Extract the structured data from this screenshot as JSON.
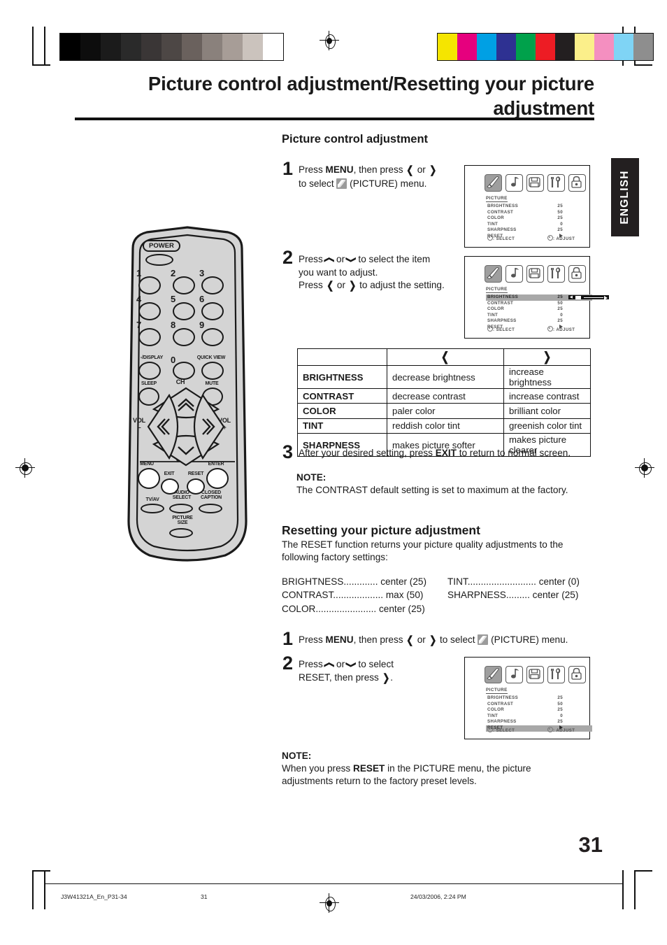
{
  "page": {
    "title": "Picture control adjustment/Resetting your picture adjustment",
    "language_tab": "ENGLISH",
    "page_number": "31"
  },
  "footer": {
    "file": "J3W41321A_En_P31-34",
    "page": "31",
    "timestamp": "24/03/2006, 2:24 PM"
  },
  "sections": {
    "picture_control": {
      "heading": "Picture control adjustment",
      "steps": [
        {
          "num": "1",
          "line1_a": "Press ",
          "line1_b": "MENU",
          "line1_c": ", then press ",
          "line1_d": " or ",
          "line2_a": "to select ",
          "line2_b": " (PICTURE) menu."
        },
        {
          "num": "2",
          "line1_a": "Press ",
          "line1_b": " or ",
          "line1_c": " to select the item",
          "line2": "you want to adjust.",
          "line3_a": "Press ",
          "line3_b": " or ",
          "line3_c": " to adjust the setting."
        },
        {
          "num": "3",
          "text_a": "After your desired setting, press ",
          "text_b": "EXIT",
          "text_c": " to return to normal screen."
        }
      ],
      "note": {
        "label": "NOTE:",
        "text": "The CONTRAST default setting is set to maximum at the factory."
      }
    },
    "resetting": {
      "heading": "Resetting your picture adjustment",
      "intro_line1": "The RESET function returns your picture quality adjustments to the",
      "intro_line2": "following factory settings:",
      "factory_settings": [
        {
          "name": "BRIGHTNESS",
          "dots": "............. ",
          "value": "center (25)"
        },
        {
          "name": "CONTRAST",
          "dots": "................... ",
          "value": "max (50)"
        },
        {
          "name": "COLOR",
          "dots": "....................... ",
          "value": "center (25)"
        },
        {
          "name": "TINT",
          "dots": ".......................... ",
          "value": "center (0)"
        },
        {
          "name": "SHARPNESS",
          "dots": "......... ",
          "value": "center (25)"
        }
      ],
      "steps": [
        {
          "num": "1",
          "a": "Press ",
          "b": "MENU",
          "c": ", then press ",
          "d": " or ",
          "e": " to select ",
          "f": " (PICTURE) menu."
        },
        {
          "num": "2",
          "line1_a": "Press ",
          "line1_b": " or ",
          "line1_c": " to select",
          "line2_a": "RESET, then press ",
          "line2_b": "."
        }
      ],
      "note": {
        "label": "NOTE:",
        "line1_a": "When you press ",
        "line1_b": "RESET",
        "line1_c": " in the PICTURE menu, the picture",
        "line2": "adjustments return to the factory preset levels."
      }
    }
  },
  "adjust_table": {
    "headers": [
      "",
      "left-arrow",
      "right-arrow"
    ],
    "rows": [
      {
        "label": "BRIGHTNESS",
        "left": "decrease brightness",
        "right": "increase brightness"
      },
      {
        "label": "CONTRAST",
        "left": "decrease contrast",
        "right": "increase contrast"
      },
      {
        "label": "COLOR",
        "left": "paler color",
        "right": "brilliant color"
      },
      {
        "label": "TINT",
        "left": "reddish color tint",
        "right": "greenish color tint"
      },
      {
        "label": "SHARPNESS",
        "left": "makes picture softer",
        "right": "makes picture clearer"
      }
    ]
  },
  "osd": {
    "tab_name": "PICTURE",
    "icons": [
      "picture-brush-icon",
      "audio-note-icon",
      "setup-icon",
      "function-tools-icon",
      "lock-icon"
    ],
    "rows": [
      {
        "name": "BRIGHTNESS",
        "value": "25"
      },
      {
        "name": "CONTRAST",
        "value": "50"
      },
      {
        "name": "COLOR",
        "value": "25"
      },
      {
        "name": "TINT",
        "value": "0"
      },
      {
        "name": "SHARPNESS",
        "value": "25"
      },
      {
        "name": "RESET",
        "value": ""
      }
    ],
    "footer_select": ": SELECT",
    "footer_adjust": ": ADJUST",
    "panel1_highlight": "",
    "panel2_highlight": "BRIGHTNESS",
    "panel3_highlight": "RESET"
  },
  "remote": {
    "power": "POWER",
    "numbers": [
      "1",
      "2",
      "3",
      "4",
      "5",
      "6",
      "7",
      "8",
      "9"
    ],
    "display": "-/DISPLAY",
    "zero": "0",
    "quick_view": "QUICK VIEW",
    "sleep": "SLEEP",
    "mute": "MUTE",
    "ch_up": "CH",
    "ch_down": "CH",
    "vol_left": "VOL",
    "vol_left_sign": "–",
    "vol_right": "VOL",
    "vol_right_sign": "+",
    "menu": "MENU",
    "enter": "ENTER",
    "exit": "EXIT",
    "reset": "RESET",
    "tv_av": "TV/AV",
    "audio_select_1": "AUDIO",
    "audio_select_2": "SELECT",
    "closed_caption_1": "CLOSED",
    "closed_caption_2": "CAPTION",
    "picture_size_1": "PICTURE",
    "picture_size_2": "SIZE"
  },
  "colors": {
    "gray_wedge": [
      "#000000",
      "#0d0d0d",
      "#1b1b1b",
      "#2a2a2a",
      "#3a3636",
      "#4d4745",
      "#6a615d",
      "#8a817c",
      "#a79d97",
      "#cbc3bd",
      "#ffffff"
    ],
    "color_bars": [
      "#f5e500",
      "#e6007e",
      "#00a0e4",
      "#2e3192",
      "#00a14b",
      "#ed1c24",
      "#231f20",
      "#fbef8a",
      "#f48fc0",
      "#7fd4f5",
      "#8e8e8e"
    ],
    "tab_bg": "#231f20"
  }
}
